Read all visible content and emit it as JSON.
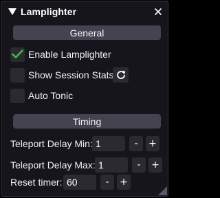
{
  "window": {
    "title": "Lamplighter",
    "collapse_icon": "triangle-down-icon",
    "close_icon": "close-icon"
  },
  "general": {
    "header": "General",
    "enable": {
      "label": "Enable Lamplighter",
      "checked": true
    },
    "show_stats": {
      "label": "Show Session Stats",
      "checked": false,
      "refresh_icon": "refresh-icon"
    },
    "auto_tonic": {
      "label": "Auto Tonic",
      "checked": false
    }
  },
  "timing": {
    "header": "Timing",
    "teleport_min": {
      "label": "Teleport Delay Min:",
      "value": "1",
      "minus": "-",
      "plus": "+"
    },
    "teleport_max": {
      "label": "Teleport Delay Max:",
      "value": "1",
      "minus": "-",
      "plus": "+"
    },
    "reset_timer": {
      "label": "Reset timer:",
      "value": "60",
      "minus": "-",
      "plus": "+"
    }
  },
  "colors": {
    "check_green": "#3fbf3f",
    "panel_bg": "#17151c",
    "header_bg": "#45434f",
    "control_bg": "#2b2a31"
  }
}
